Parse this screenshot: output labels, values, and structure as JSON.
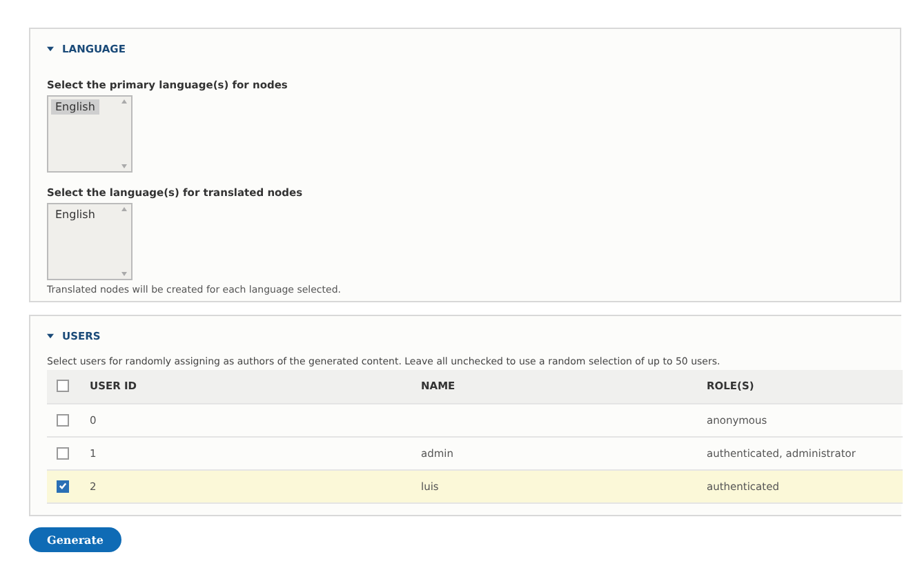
{
  "language": {
    "title": "LANGUAGE",
    "expanded": true,
    "primary": {
      "label": "Select the primary language(s) for nodes",
      "options": [
        {
          "label": "English",
          "selected": true
        }
      ]
    },
    "translated": {
      "label": "Select the language(s) for translated nodes",
      "options": [
        {
          "label": "English",
          "selected": false
        }
      ]
    },
    "description": "Translated nodes will be created for each language selected."
  },
  "users": {
    "title": "USERS",
    "expanded": true,
    "description": "Select users for randomly assigning as authors of the generated content. Leave all unchecked to use a random selection of up to 50 users.",
    "table": {
      "select_all": {
        "checked": false
      },
      "columns": [
        "USER ID",
        "NAME",
        "ROLE(S)"
      ],
      "rows": [
        {
          "cells": [
            "0",
            "",
            "anonymous"
          ],
          "selected": false
        },
        {
          "cells": [
            "1",
            "admin",
            "authenticated, administrator"
          ],
          "selected": false
        },
        {
          "cells": [
            "2",
            "luis",
            "authenticated"
          ],
          "selected": true
        }
      ]
    }
  },
  "generate_button": "Generate"
}
